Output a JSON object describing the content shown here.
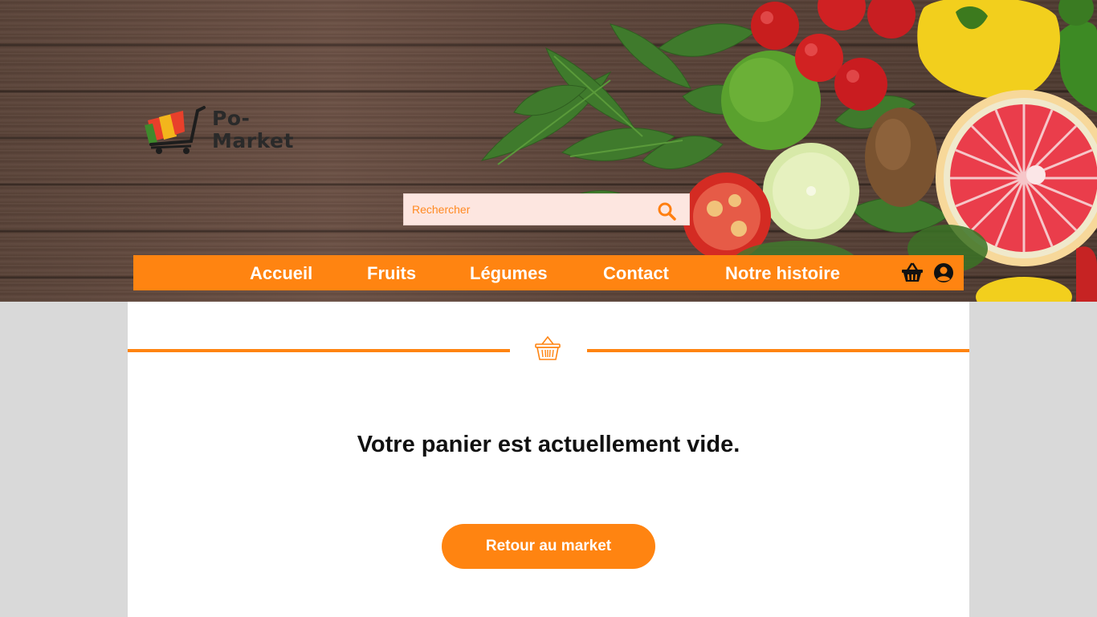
{
  "brand": {
    "name_line1": "Po-",
    "name_line2": "Market"
  },
  "search": {
    "placeholder": "Rechercher",
    "icon": "search-icon"
  },
  "nav": {
    "items": [
      {
        "label": "Accueil"
      },
      {
        "label": "Fruits"
      },
      {
        "label": "Légumes"
      },
      {
        "label": "Contact"
      },
      {
        "label": "Notre histoire"
      }
    ],
    "icons": [
      "basket-icon",
      "user-icon"
    ]
  },
  "cart": {
    "divider_icon": "basket-icon",
    "empty_message": "Votre panier est actuellement vide.",
    "back_button_label": "Retour au market"
  },
  "colors": {
    "accent": "#ff8411",
    "search_bg": "#fde6e0",
    "page_bg": "#d9d9d9",
    "panel_bg": "#ffffff"
  }
}
